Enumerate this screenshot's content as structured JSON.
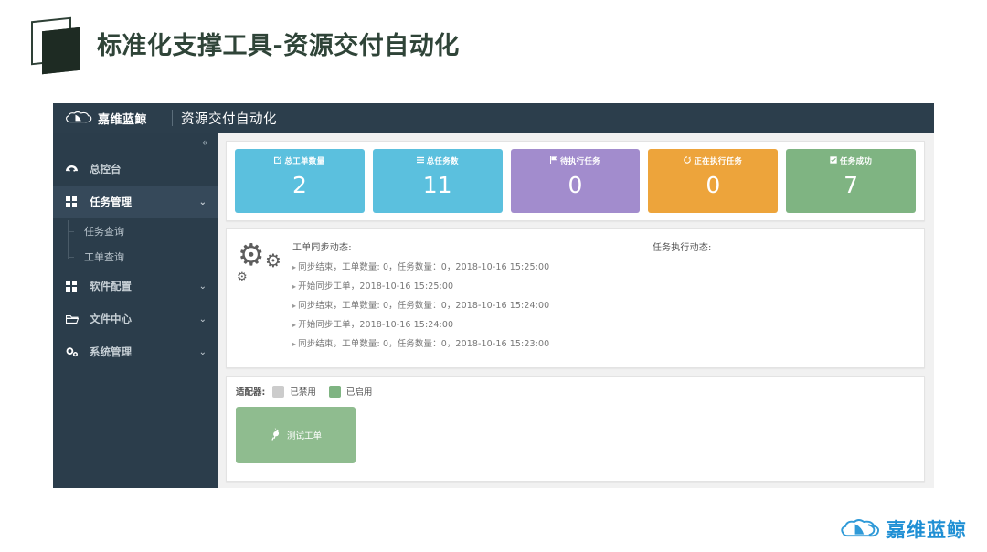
{
  "slide": {
    "title": "标准化支撑工具-资源交付自动化",
    "title_icon": "layered-pages-icon"
  },
  "app": {
    "topbar": {
      "brand_text": "嘉维蓝鲸",
      "brand_icon": "whale-cloud-logo-icon",
      "page_title": "资源交付自动化"
    },
    "sidebar": {
      "collapse_icon": "«",
      "items": [
        {
          "label": "总控台",
          "icon": "dashboard-icon",
          "caret": "",
          "active": false
        },
        {
          "label": "任务管理",
          "icon": "grid-icon",
          "caret": "⌄",
          "active": true
        },
        {
          "label": "软件配置",
          "icon": "grid-icon",
          "caret": "⌄",
          "active": false
        },
        {
          "label": "文件中心",
          "icon": "folder-open-icon",
          "caret": "⌄",
          "active": false
        },
        {
          "label": "系统管理",
          "icon": "gears-icon",
          "caret": "⌄",
          "active": false
        }
      ],
      "sub_items": [
        {
          "label": "任务查询"
        },
        {
          "label": "工单查询"
        }
      ]
    },
    "stats": [
      {
        "label": "总工单数量",
        "value": "2",
        "icon": "edit-square-icon",
        "color": "#5bc0de"
      },
      {
        "label": "总任务数",
        "value": "11",
        "icon": "list-icon",
        "color": "#5bc0de"
      },
      {
        "label": "待执行任务",
        "value": "0",
        "icon": "flag-icon",
        "color": "#a28ccd"
      },
      {
        "label": "正在执行任务",
        "value": "0",
        "icon": "refresh-icon",
        "color": "#eda43b"
      },
      {
        "label": "任务成功",
        "value": "7",
        "icon": "check-square-icon",
        "color": "#7fb482"
      }
    ],
    "log": {
      "gear_icon": "gears-decoration-icon",
      "left_title": "工单同步动态:",
      "right_title": "任务执行动态:",
      "left_entries": [
        "同步结束，工单数量: 0，任务数量：0，2018-10-16 15:25:00",
        "开始同步工单，2018-10-16 15:25:00",
        "同步结束，工单数量: 0，任务数量：0，2018-10-16 15:24:00",
        "开始同步工单，2018-10-16 15:24:00",
        "同步结束，工单数量: 0，任务数量：0，2018-10-16 15:23:00"
      ],
      "right_entries": []
    },
    "adapter": {
      "label": "适配器:",
      "disabled_text": "已禁用",
      "disabled_color": "#cccccc",
      "enabled_text": "已启用",
      "enabled_color": "#7fb482",
      "card": {
        "label": "测试工单",
        "icon": "plug-icon",
        "color": "#8fbc8f"
      }
    }
  },
  "footer": {
    "logo_text": "嘉维蓝鲸",
    "logo_icon": "whale-cloud-logo-icon"
  }
}
